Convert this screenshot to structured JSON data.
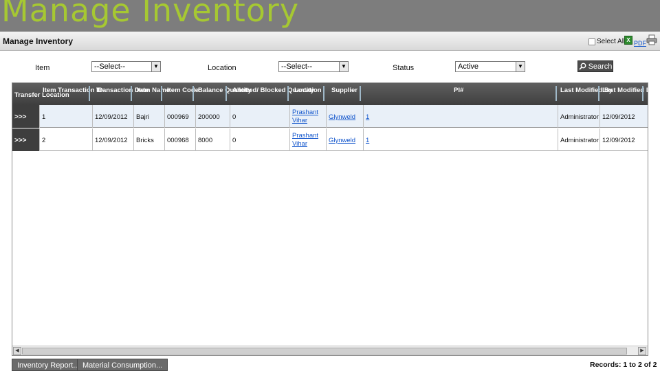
{
  "slide": {
    "title": "Manage Inventory"
  },
  "panel": {
    "title": "Manage Inventory",
    "select_all_label": "Select All",
    "pdf_label": "PDF"
  },
  "filters": {
    "item_label": "Item",
    "item_value": "--Select--",
    "location_label": "Location",
    "location_value": "--Select--",
    "status_label": "Status",
    "status_value": "Active",
    "search_label": "Search"
  },
  "grid": {
    "columns": {
      "transfer_location": "Transfer Location",
      "item_transaction_id": "Item Transaction ID",
      "transaction_date": "Transaction Date",
      "item_name": "Item Name",
      "item_code": "Item Code",
      "balance_quantity": "Balance Quantity",
      "allotted_blocked_quantity": "Allotted/ Blocked Quantity",
      "location": "Location",
      "supplier": "Supplier",
      "pi": "PI#",
      "last_modified_by": "Last Modified By",
      "last_modified_date": "Last Modified D"
    },
    "rows": [
      {
        "transfer": ">>>",
        "transaction_id": "1",
        "transaction_date": "12/09/2012",
        "item_name": "Bajri",
        "item_code": "000969",
        "balance_quantity": "200000",
        "allotted_blocked": "0",
        "location": "Prashant Vihar",
        "supplier": "Glynweld",
        "pi": "1",
        "last_modified_by": "Administrator",
        "last_modified_date": "12/09/2012"
      },
      {
        "transfer": ">>>",
        "transaction_id": "2",
        "transaction_date": "12/09/2012",
        "item_name": "Bricks",
        "item_code": "000968",
        "balance_quantity": "8000",
        "allotted_blocked": "0",
        "location": "Prashant Vihar",
        "supplier": "Glynweld",
        "pi": "1",
        "last_modified_by": "Administrator",
        "last_modified_date": "12/09/2012"
      }
    ]
  },
  "footer": {
    "inventory_report_label": "Inventory Report...",
    "material_consumption_label": "Material Consumption...",
    "records_text": "Records: 1 to 2 of 2"
  },
  "icons": {
    "excel": "excel-icon",
    "print": "print-icon",
    "search": "magnifier-icon",
    "dropdown": "chevron-down-icon"
  },
  "colors": {
    "title_green": "#a6c832",
    "top_band": "#7d7d7d",
    "header_dark": "#3e3e3e",
    "row_alt": "#e9f0f8",
    "link": "#1155cc"
  }
}
